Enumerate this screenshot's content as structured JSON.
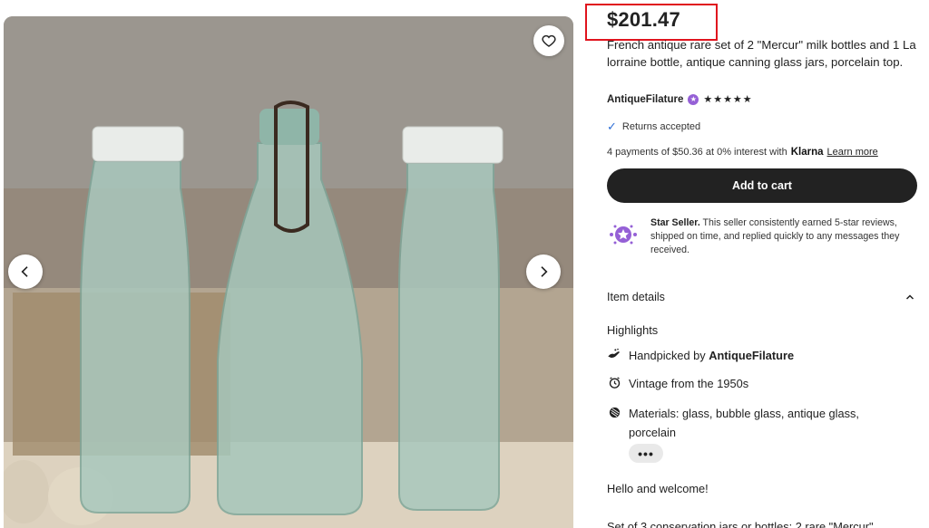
{
  "listing": {
    "price": "$201.47",
    "title": "French antique rare set of 2 \"Mercur\" milk bottles and 1 La lorraine bottle, antique canning glass jars, porcelain top.",
    "image_alt": "Three antique green glass bottles with porcelain swing tops"
  },
  "shop": {
    "name": "AntiqueFilature",
    "rating_stars": "★★★★★",
    "rating_value": 5
  },
  "returns": {
    "label": "Returns accepted"
  },
  "klarna": {
    "text": "4 payments of $50.36 at 0% interest with",
    "logo": "Klarna",
    "link": "Learn more"
  },
  "cart": {
    "button_label": "Add to cart"
  },
  "star_seller": {
    "title": "Star Seller.",
    "text": "This seller consistently earned 5-star reviews, shipped on time, and replied quickly to any messages they received."
  },
  "item_details": {
    "heading": "Item details",
    "highlights_heading": "Highlights",
    "handpicked_prefix": "Handpicked by",
    "handpicked_shop": "AntiqueFilature",
    "vintage": "Vintage from the 1950s",
    "materials": "Materials: glass, bubble glass, antique glass, porcelain",
    "more_label": "•••"
  },
  "description": {
    "greeting": "Hello and welcome!",
    "first_line_peek": "Set of 3 conservation jars or bottles: 2 rare \"Mercur\""
  },
  "icons": {
    "favorite": "heart-icon",
    "prev": "chevron-left-icon",
    "next": "chevron-right-icon",
    "collapse": "chevron-up-icon"
  },
  "colors": {
    "accent_dark": "#222222",
    "highlight_box": "#e0141e",
    "star_seller_purple": "#9560d6",
    "check_blue": "#2f6fd6"
  }
}
